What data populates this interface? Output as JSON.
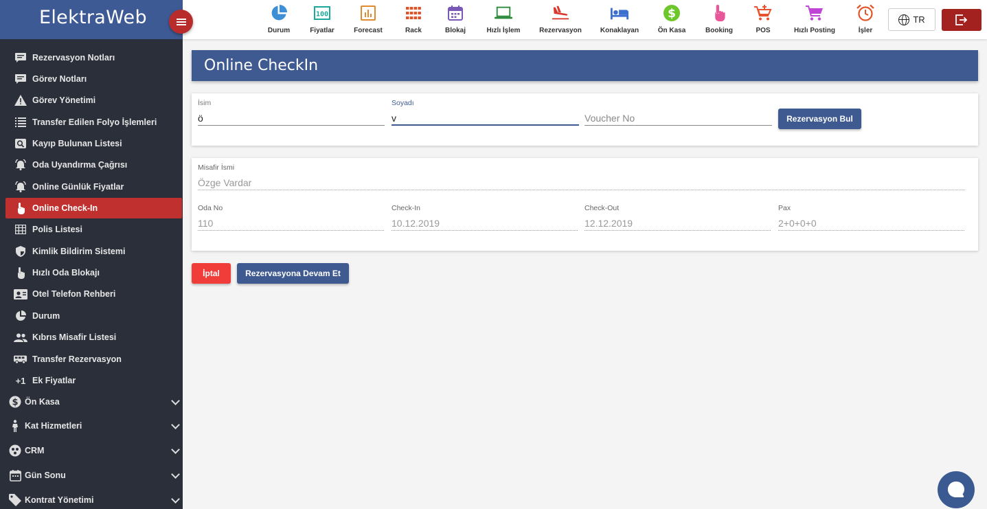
{
  "brand": {
    "name": "ElektraWeb"
  },
  "sidebar": {
    "items": [
      {
        "label": "Rezervasyon Notları",
        "icon": "note-icon"
      },
      {
        "label": "Görev Notları",
        "icon": "note-icon"
      },
      {
        "label": "Görev Yönetimi",
        "icon": "warning-icon"
      },
      {
        "label": "Transfer Edilen Folyo İşlemleri",
        "icon": "list-icon"
      },
      {
        "label": "Kayıp Bulunan Listesi",
        "icon": "search-icon"
      },
      {
        "label": "Oda Uyandırma Çağrısı",
        "icon": "alarm-bell-icon"
      },
      {
        "label": "Online Günlük Fiyatlar",
        "icon": "alarm-bell-icon"
      },
      {
        "label": "Online Check-In",
        "icon": "touch-icon",
        "active": true
      },
      {
        "label": "Polis Listesi",
        "icon": "table-icon"
      },
      {
        "label": "Kimlik Bildirim Sistemi",
        "icon": "shield-icon"
      },
      {
        "label": "Hızlı Oda Blokajı",
        "icon": "touch-icon"
      },
      {
        "label": "Otel Telefon Rehberi",
        "icon": "contact-card-icon"
      },
      {
        "label": "Durum",
        "icon": "pie-chart-icon"
      },
      {
        "label": "Kıbrıs Misafir Listesi",
        "icon": "people-icon"
      },
      {
        "label": "Transfer Rezervasyon",
        "icon": "bus-icon"
      },
      {
        "label": "Ek Fiyatlar",
        "icon": "plus-one-icon"
      }
    ],
    "groups": [
      {
        "label": "Ön Kasa",
        "icon": "dollar-icon"
      },
      {
        "label": "Kat Hizmetleri",
        "icon": "housekeeper-icon"
      },
      {
        "label": "CRM",
        "icon": "crm-icon"
      },
      {
        "label": "Gün Sonu",
        "icon": "calendar-icon"
      },
      {
        "label": "Kontrat Yönetimi",
        "icon": "tag-icon"
      }
    ]
  },
  "toolbar": {
    "items": [
      {
        "label": "Durum",
        "icon": "pie-chart-icon",
        "color": "#3d8fd6"
      },
      {
        "label": "Fiyatlar",
        "icon": "price-icon",
        "color": "#1aa89a"
      },
      {
        "label": "Forecast",
        "icon": "bar-chart-icon",
        "color": "#e08a2c"
      },
      {
        "label": "Rack",
        "icon": "grid-icon",
        "color": "#e0542a"
      },
      {
        "label": "Blokaj",
        "icon": "calendar-icon",
        "color": "#7a58b8"
      },
      {
        "label": "Hızlı İşlem",
        "icon": "laptop-icon",
        "color": "#2a8a3a"
      },
      {
        "label": "Rezervasyon",
        "icon": "plane-icon",
        "color": "#d9382e"
      },
      {
        "label": "Konaklayan",
        "icon": "bed-icon",
        "color": "#3b6fd0"
      },
      {
        "label": "Ön Kasa",
        "icon": "dollar-icon",
        "color": "#6ec72a"
      },
      {
        "label": "Booking",
        "icon": "touch-icon",
        "color": "#e9579b"
      },
      {
        "label": "POS",
        "icon": "cart-add-icon",
        "color": "#e8532f"
      },
      {
        "label": "Hızlı Posting",
        "icon": "cart-icon",
        "color": "#c045d6"
      },
      {
        "label": "İşler",
        "icon": "alarm-clock-icon",
        "color": "#e0562a"
      }
    ],
    "language": "TR"
  },
  "page": {
    "title": "Online CheckIn"
  },
  "search": {
    "name_label": "İsim",
    "name_value": "ö",
    "surname_label": "Soyadı",
    "surname_value": "v",
    "voucher_placeholder": "Voucher No",
    "find_button": "Rezervasyon Bul"
  },
  "result": {
    "guest_label": "Misafir İsmi",
    "guest_value": "Özge Vardar",
    "room_label": "Oda No",
    "room_value": "110",
    "checkin_label": "Check-In",
    "checkin_value": "10.12.2019",
    "checkout_label": "Check-Out",
    "checkout_value": "12.12.2019",
    "pax_label": "Pax",
    "pax_value": "2+0+0+0"
  },
  "actions": {
    "cancel": "İptal",
    "continue": "Rezervasyona Devam Et"
  },
  "colors": {
    "brand_blue": "#3f5a91",
    "sidebar_bg": "#2b2f3a",
    "active_red": "#c0302e",
    "cancel_red": "#f03d3a"
  }
}
